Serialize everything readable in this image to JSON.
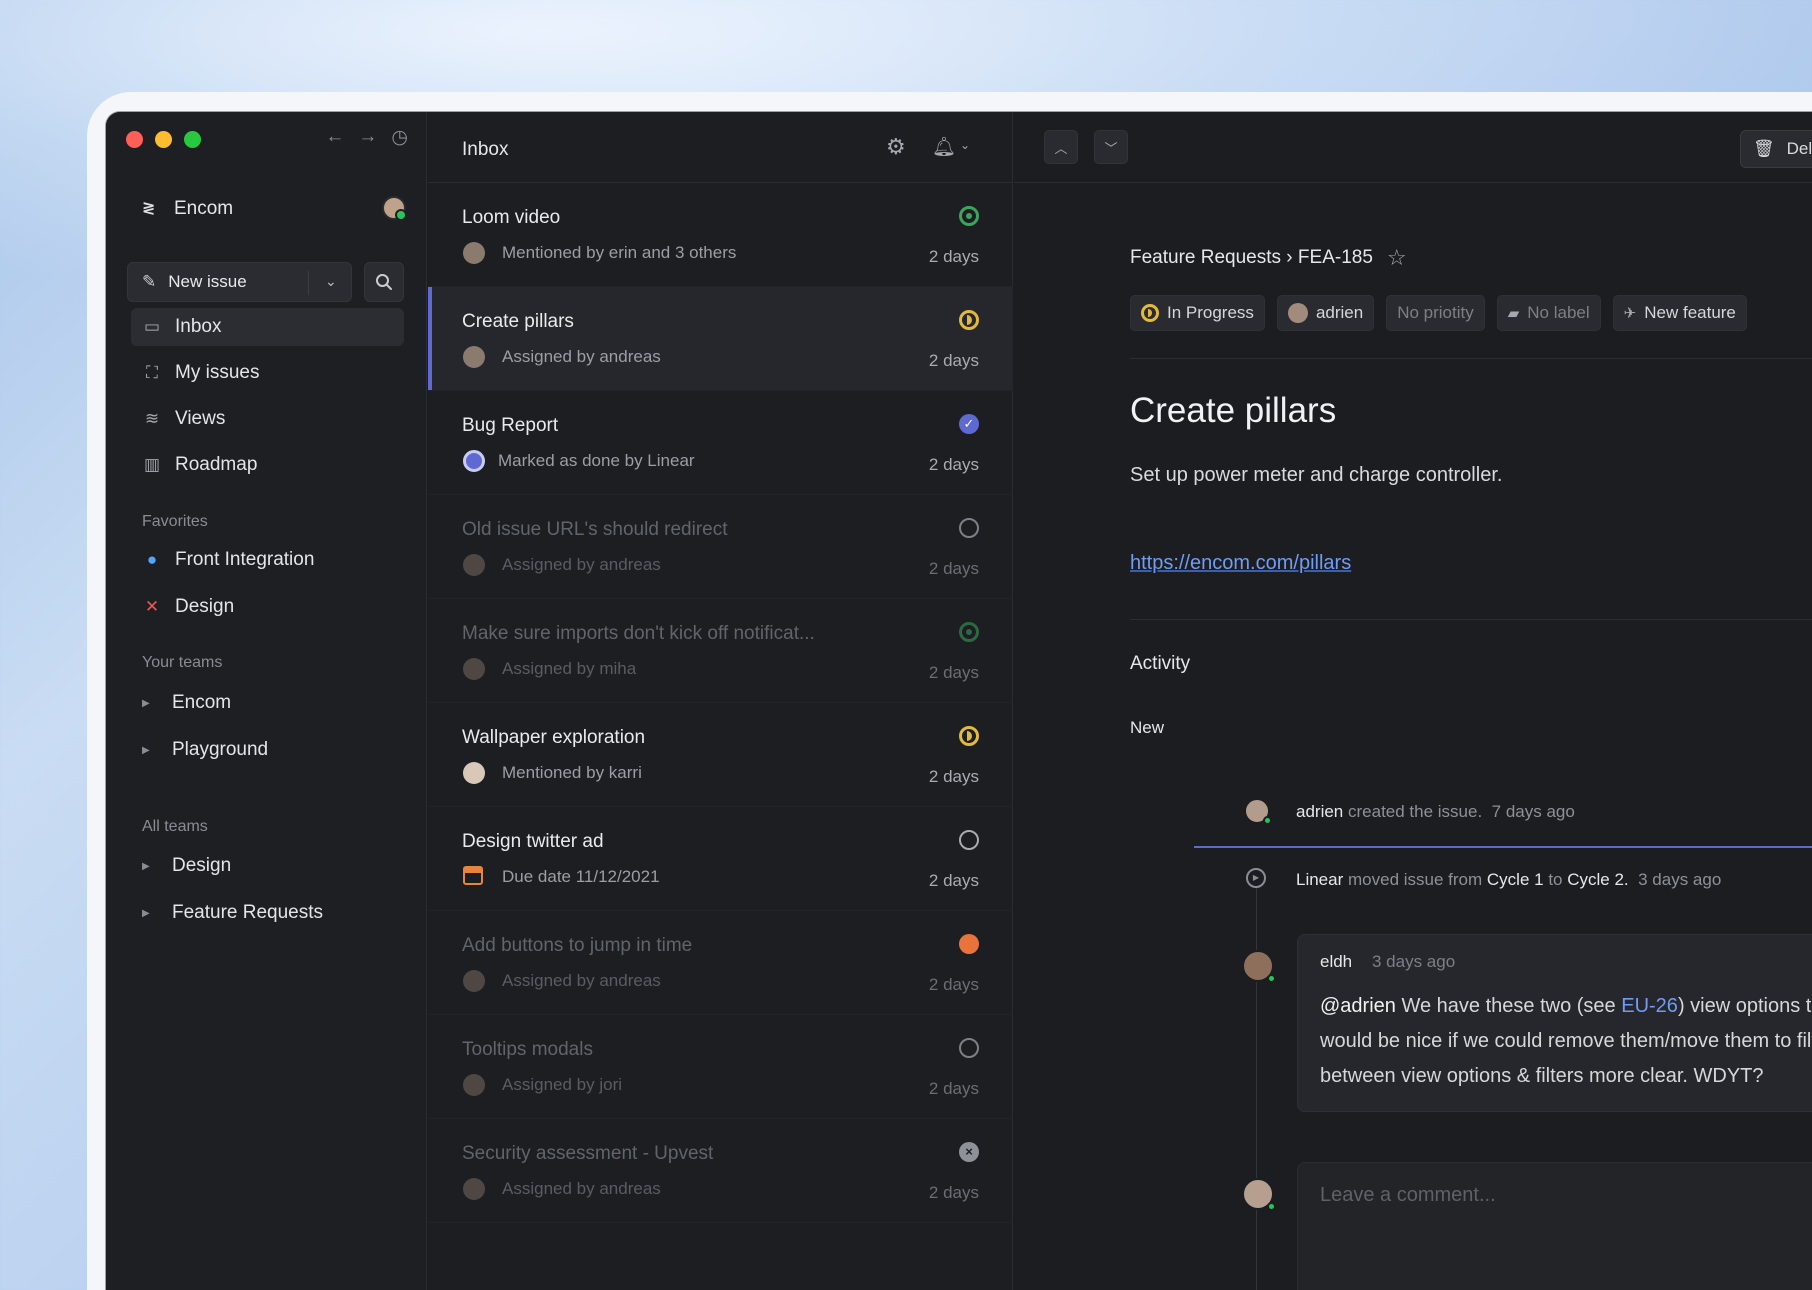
{
  "sidebar": {
    "workspace": "Encom",
    "new_issue": "New issue",
    "nav": [
      {
        "label": "Inbox",
        "icon": "inbox-icon"
      },
      {
        "label": "My issues",
        "icon": "target-icon"
      },
      {
        "label": "Views",
        "icon": "layers-icon"
      },
      {
        "label": "Roadmap",
        "icon": "map-icon"
      }
    ],
    "favorites_label": "Favorites",
    "favorites": [
      {
        "label": "Front Integration",
        "icon": "chat-bubble-icon",
        "color": "#4ea7fc"
      },
      {
        "label": "Design",
        "icon": "figma-cross-icon",
        "color": "#eb5757"
      }
    ],
    "your_teams_label": "Your teams",
    "your_teams": [
      "Encom",
      "Playground"
    ],
    "all_teams_label": "All teams",
    "all_teams": [
      "Design",
      "Feature Requests"
    ]
  },
  "inbox": {
    "title": "Inbox",
    "items": [
      {
        "title": "Loom video",
        "subtitle": "Mentioned by erin and 3 others",
        "time": "2 days",
        "status": "in-progress-green",
        "faded": false
      },
      {
        "title": "Create pillars",
        "subtitle": "Assigned by andreas",
        "time": "2 days",
        "status": "in-progress",
        "faded": false,
        "selected": true
      },
      {
        "title": "Bug Report",
        "subtitle": "Marked as done by Linear",
        "time": "2 days",
        "status": "done",
        "faded": false
      },
      {
        "title": "Old issue URL's should redirect",
        "subtitle": "Assigned by andreas",
        "time": "2 days",
        "status": "todo",
        "faded": true
      },
      {
        "title": "Make sure imports don't kick off notificat...",
        "subtitle": "Assigned by miha",
        "time": "2 days",
        "status": "in-progress-green",
        "faded": true
      },
      {
        "title": "Wallpaper exploration",
        "subtitle": "Mentioned by karri",
        "time": "2 days",
        "status": "in-progress",
        "faded": false
      },
      {
        "title": "Design twitter ad",
        "subtitle": "Due date 11/12/2021",
        "time": "2 days",
        "status": "todo",
        "faded": false
      },
      {
        "title": "Add buttons to jump in time",
        "subtitle": "Assigned by andreas",
        "time": "2 days",
        "status": "orange",
        "faded": true
      },
      {
        "title": "Tooltips modals",
        "subtitle": "Assigned by jori",
        "time": "2 days",
        "status": "todo",
        "faded": true
      },
      {
        "title": "Security assessment - Upvest",
        "subtitle": "Assigned by andreas",
        "time": "2 days",
        "status": "canceled",
        "faded": true
      }
    ]
  },
  "detail": {
    "delete_label": "Dele",
    "breadcrumb": "Feature Requests › FEA-185",
    "props": {
      "status": "In Progress",
      "assignee": "adrien",
      "priority": "No priotity",
      "label": "No label",
      "project": "New feature"
    },
    "title": "Create pillars",
    "description": "Set up power meter and charge controller.",
    "link": "https://encom.com/pillars",
    "activity_label": "Activity",
    "new_label": "New",
    "events": {
      "created": {
        "actor": "adrien",
        "text": "created the issue.",
        "time": "7 days ago"
      },
      "moved": {
        "actor": "Linear",
        "text1": "moved issue from",
        "from": "Cycle 1",
        "text2": "to",
        "to": "Cycle 2.",
        "time": "3 days ago"
      }
    },
    "comment": {
      "author": "eldh",
      "time": "3 days ago",
      "mention": "@adrien",
      "line1_a": "We have these two (see",
      "ref": "EU-26",
      "line1_b": ") view options tha",
      "line2": "would be nice if we could remove them/move them to filte",
      "line3": "between view options & filters more clear. WDYT?"
    },
    "comment_placeholder": "Leave a comment..."
  },
  "colors": {
    "accent": "#5e6ad2",
    "in_progress": "#e2b93b",
    "done_green": "#3ba55d",
    "link": "#6f9cf5"
  }
}
